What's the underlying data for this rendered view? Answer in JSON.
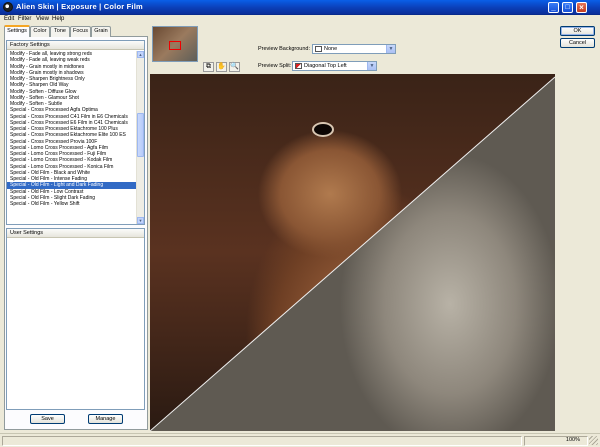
{
  "window": {
    "title": "Alien Skin  |  Exposure  |  Color Film",
    "minimize": "_",
    "maximize": "□",
    "close": "×"
  },
  "menu": [
    "Edit",
    "Filter",
    "View",
    "Help"
  ],
  "tabs": [
    "Settings",
    "Color",
    "Tone",
    "Focus",
    "Grain"
  ],
  "factory": {
    "header": "Factory Settings",
    "items": [
      "Modify - Fade all, leaving strong reds",
      "Modify - Fade all, leaving weak reds",
      "Modify - Grain mostly in midtones",
      "Modify - Grain mostly in shadows",
      "Modify - Sharpen Brightness Only",
      "Modify - Sharpen Old Way",
      "Modify - Soften - Diffuse Glow",
      "Modify - Soften - Glamour Shot",
      "Modify - Soften - Subtle",
      "Special - Cross Processed Agfa Optima",
      "Special - Cross Processed C41 Film in E6 Chemicals",
      "Special - Cross Processed E6 Film in C41 Chemicals",
      "Special - Cross Processed Ektachrome 100 Plus",
      "Special - Cross Processed Ektachrome Elite 100 ES",
      "Special - Cross Processed Provia 100F",
      "Special - Lomo Cross Processed - Agfa Film",
      "Special - Lomo Cross Processed - Fuji Film",
      "Special - Lomo Cross Processed - Kodak Film",
      "Special - Lomo Cross Processed - Konica Film",
      "Special - Old Film - Black and White",
      "Special - Old Film - Intense Fading",
      "Special - Old Film - Light and Dark Fading",
      "Special - Old Film - Low Contrast",
      "Special - Old Film - Slight Dark Fading",
      "Special - Old Film - Yellow Shift"
    ],
    "selected_index": 21
  },
  "user": {
    "header": "User Settings"
  },
  "buttons": {
    "save": "Save",
    "manage": "Manage",
    "ok": "OK",
    "cancel": "Cancel"
  },
  "preview": {
    "background_label": "Preview Background:",
    "background_value": "None",
    "split_label": "Preview Split:",
    "split_value": "Diagonal Top Left"
  },
  "status": {
    "zoom": "100%"
  },
  "colors": {
    "accent": "#316ac5",
    "titlebar": "#0a5fe8"
  }
}
